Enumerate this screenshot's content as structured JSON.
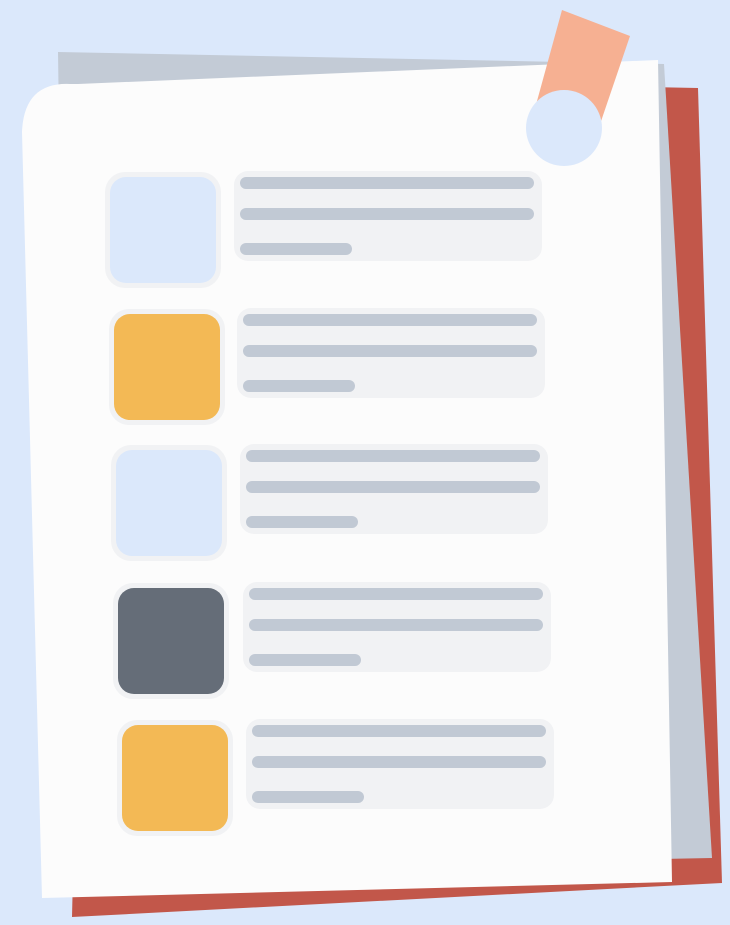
{
  "colors": {
    "background": "#dbe8fb",
    "back_sheet": "#c2574a",
    "middle_sheet": "#c3cbd6",
    "front_sheet": "#fcfcfc",
    "tape": "#f6b092",
    "hole": "#dbe8fb",
    "text_line": "#c1c9d4",
    "row_halo": "#f1f2f4"
  },
  "icon": "checklist-document-illustration",
  "rows": [
    {
      "square": "light-blue",
      "color": "#dbe8fb"
    },
    {
      "square": "amber",
      "color": "#f3b955"
    },
    {
      "square": "light-blue",
      "color": "#dbe8fb"
    },
    {
      "square": "slate",
      "color": "#656d78"
    },
    {
      "square": "amber",
      "color": "#f3b955"
    }
  ]
}
